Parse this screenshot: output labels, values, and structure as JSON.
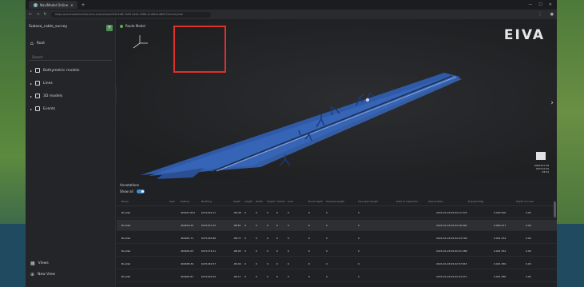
{
  "colors": {
    "accent": "#3a8fd6",
    "surface_blue": "#3766b8",
    "highlight": "#e0302c",
    "status_green": "#4caf50"
  },
  "browser": {
    "tab_title": "NaviModel Online",
    "url": "https://navimodelonline.eiva.com/view/b1f4c2d8-7a93-4e0c-9f6b-2c4f0a1d8e57/surveyline",
    "window_controls": [
      "—",
      "☐",
      "✕"
    ]
  },
  "sidebar": {
    "title": "Subsea_cable_survey",
    "home_label": "Root",
    "search_placeholder": "Search",
    "groups": [
      {
        "label": "Bathymetric models"
      },
      {
        "label": "Lines"
      },
      {
        "label": "3D models"
      },
      {
        "label": "Events"
      }
    ],
    "bottom_items": [
      {
        "label": "Views"
      },
      {
        "label": "New View"
      }
    ]
  },
  "viewport": {
    "status_label": "Route Model",
    "logo": "EIVA",
    "coords": [
      "6462321.38",
      "463712.09",
      "-78.04"
    ]
  },
  "table": {
    "title": "Annotations",
    "toggle_label": "Show all",
    "columns": [
      "Name",
      "Type",
      "Easting",
      "Northing",
      "Depth",
      "Length",
      "Width",
      "Height",
      "Volume",
      "Area",
      "Burial depth",
      "Exposed length",
      "Free span length",
      "Date of inspection",
      "Pipe position",
      "Exposed flag",
      "Depth of cover"
    ],
    "rows": [
      [
        "Boulder",
        "",
        "464612.841",
        "6471149.11",
        "-88.48",
        "0",
        "0",
        "0",
        "0",
        "0",
        "0",
        "0",
        "0",
        "2024-01-18 09:42:11.574",
        "0.000 000",
        "0.00"
      ],
      [
        "Boulder",
        "",
        "464619.24",
        "6471157.52",
        "-88.61",
        "0",
        "0",
        "0",
        "0",
        "0",
        "0",
        "0",
        "0",
        "2024-01-18 09:42:18.092",
        "0.000 017",
        "0.00"
      ],
      [
        "Boulder",
        "",
        "464625.71",
        "6471165.86",
        "-88.77",
        "0",
        "0",
        "0",
        "0",
        "0",
        "0",
        "0",
        "0",
        "2024-01-18 09:42:24.706",
        "0.001 034",
        "0.00"
      ],
      [
        "Boulder",
        "",
        "464632.05",
        "6471174.21",
        "-88.93",
        "0",
        "0",
        "0",
        "0",
        "0",
        "0",
        "0",
        "0",
        "2024-01-18 09:42:31.288",
        "0.001 052",
        "0.00"
      ],
      [
        "Boulder",
        "",
        "464638.39",
        "6471182.57",
        "-89.04",
        "0",
        "0",
        "0",
        "0",
        "0",
        "0",
        "0",
        "0",
        "2024-01-18 09:42:37.815",
        "0.001 069",
        "0.00"
      ],
      [
        "Boulder",
        "",
        "464644.81",
        "6471190.94",
        "-89.17",
        "0",
        "0",
        "0",
        "0",
        "0",
        "0",
        "0",
        "0",
        "2024-01-18 09:42:44.371",
        "0.001 086",
        "0.00"
      ]
    ]
  }
}
